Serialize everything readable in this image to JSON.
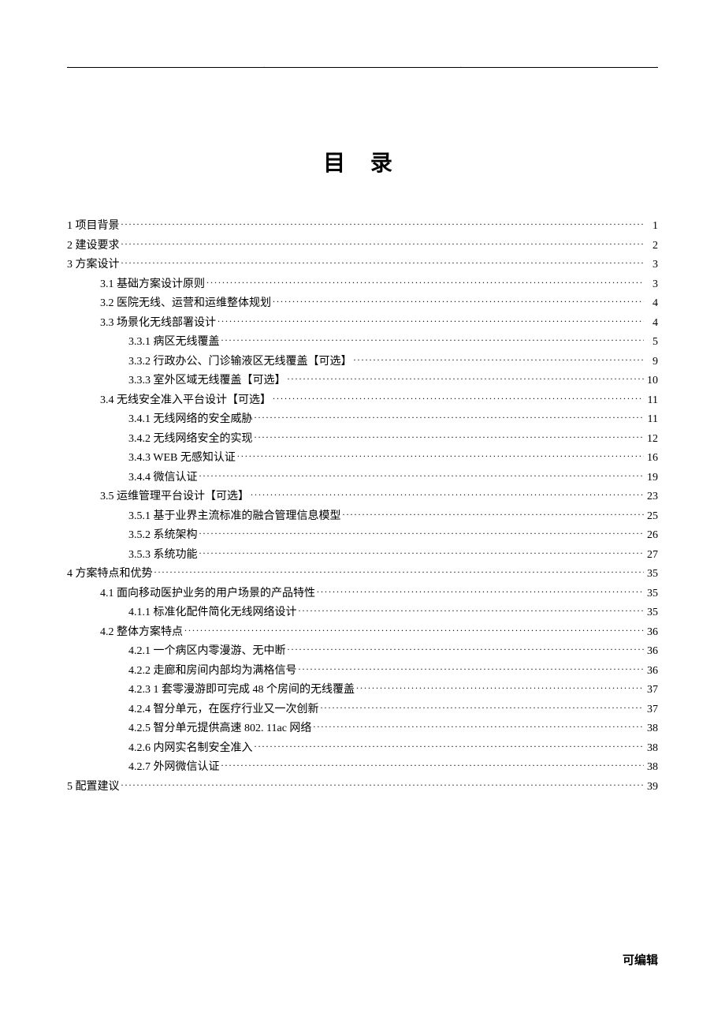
{
  "title": "目 录",
  "footer": "可编辑",
  "entries": [
    {
      "level": 1,
      "text": "1 项目背景",
      "page": "1"
    },
    {
      "level": 1,
      "text": "2 建设要求",
      "page": "2"
    },
    {
      "level": 1,
      "text": "3 方案设计",
      "page": "3"
    },
    {
      "level": 2,
      "text": "3.1 基础方案设计原则",
      "page": "3"
    },
    {
      "level": 2,
      "text": "3.2 医院无线、运营和运维整体规划",
      "page": "4"
    },
    {
      "level": 2,
      "text": "3.3 场景化无线部署设计",
      "page": "4"
    },
    {
      "level": 3,
      "text": "3.3.1 病区无线覆盖",
      "page": "5"
    },
    {
      "level": 3,
      "text": "3.3.2 行政办公、门诊输液区无线覆盖【可选】",
      "page": "9"
    },
    {
      "level": 3,
      "text": "3.3.3 室外区域无线覆盖【可选】",
      "page": "10"
    },
    {
      "level": 2,
      "text": "3.4 无线安全准入平台设计【可选】",
      "page": "11"
    },
    {
      "level": 3,
      "text": "3.4.1 无线网络的安全威胁",
      "page": "11"
    },
    {
      "level": 3,
      "text": "3.4.2 无线网络安全的实现",
      "page": "12"
    },
    {
      "level": 3,
      "text": "3.4.3 WEB 无感知认证",
      "page": "16"
    },
    {
      "level": 3,
      "text": "3.4.4 微信认证",
      "page": "19"
    },
    {
      "level": 2,
      "text": "3.5 运维管理平台设计【可选】",
      "page": "23"
    },
    {
      "level": 3,
      "text": "3.5.1 基于业界主流标准的融合管理信息模型",
      "page": "25"
    },
    {
      "level": 3,
      "text": "3.5.2 系统架构",
      "page": "26"
    },
    {
      "level": 3,
      "text": "3.5.3 系统功能",
      "page": "27"
    },
    {
      "level": 1,
      "text": "4 方案特点和优势",
      "page": "35"
    },
    {
      "level": 2,
      "text": "4.1 面向移动医护业务的用户场景的产品特性",
      "page": "35"
    },
    {
      "level": 3,
      "text": "4.1.1 标准化配件简化无线网络设计",
      "page": "35"
    },
    {
      "level": 2,
      "text": "4.2 整体方案特点",
      "page": "36"
    },
    {
      "level": 3,
      "text": "4.2.1 一个病区内零漫游、无中断",
      "page": "36"
    },
    {
      "level": 3,
      "text": "4.2.2 走廊和房间内部均为满格信号",
      "page": "36"
    },
    {
      "level": 3,
      "text": "4.2.3 1 套零漫游即可完成 48 个房间的无线覆盖",
      "page": "37"
    },
    {
      "level": 3,
      "text": "4.2.4 智分单元，在医疗行业又一次创新",
      "page": "37"
    },
    {
      "level": 3,
      "text": "4.2.5 智分单元提供高速 802. 11ac 网络",
      "page": "38"
    },
    {
      "level": 3,
      "text": "4.2.6 内网实名制安全准入",
      "page": "38"
    },
    {
      "level": 3,
      "text": "4.2.7 外网微信认证",
      "page": "38"
    },
    {
      "level": 1,
      "text": "5 配置建议",
      "page": "39"
    }
  ]
}
